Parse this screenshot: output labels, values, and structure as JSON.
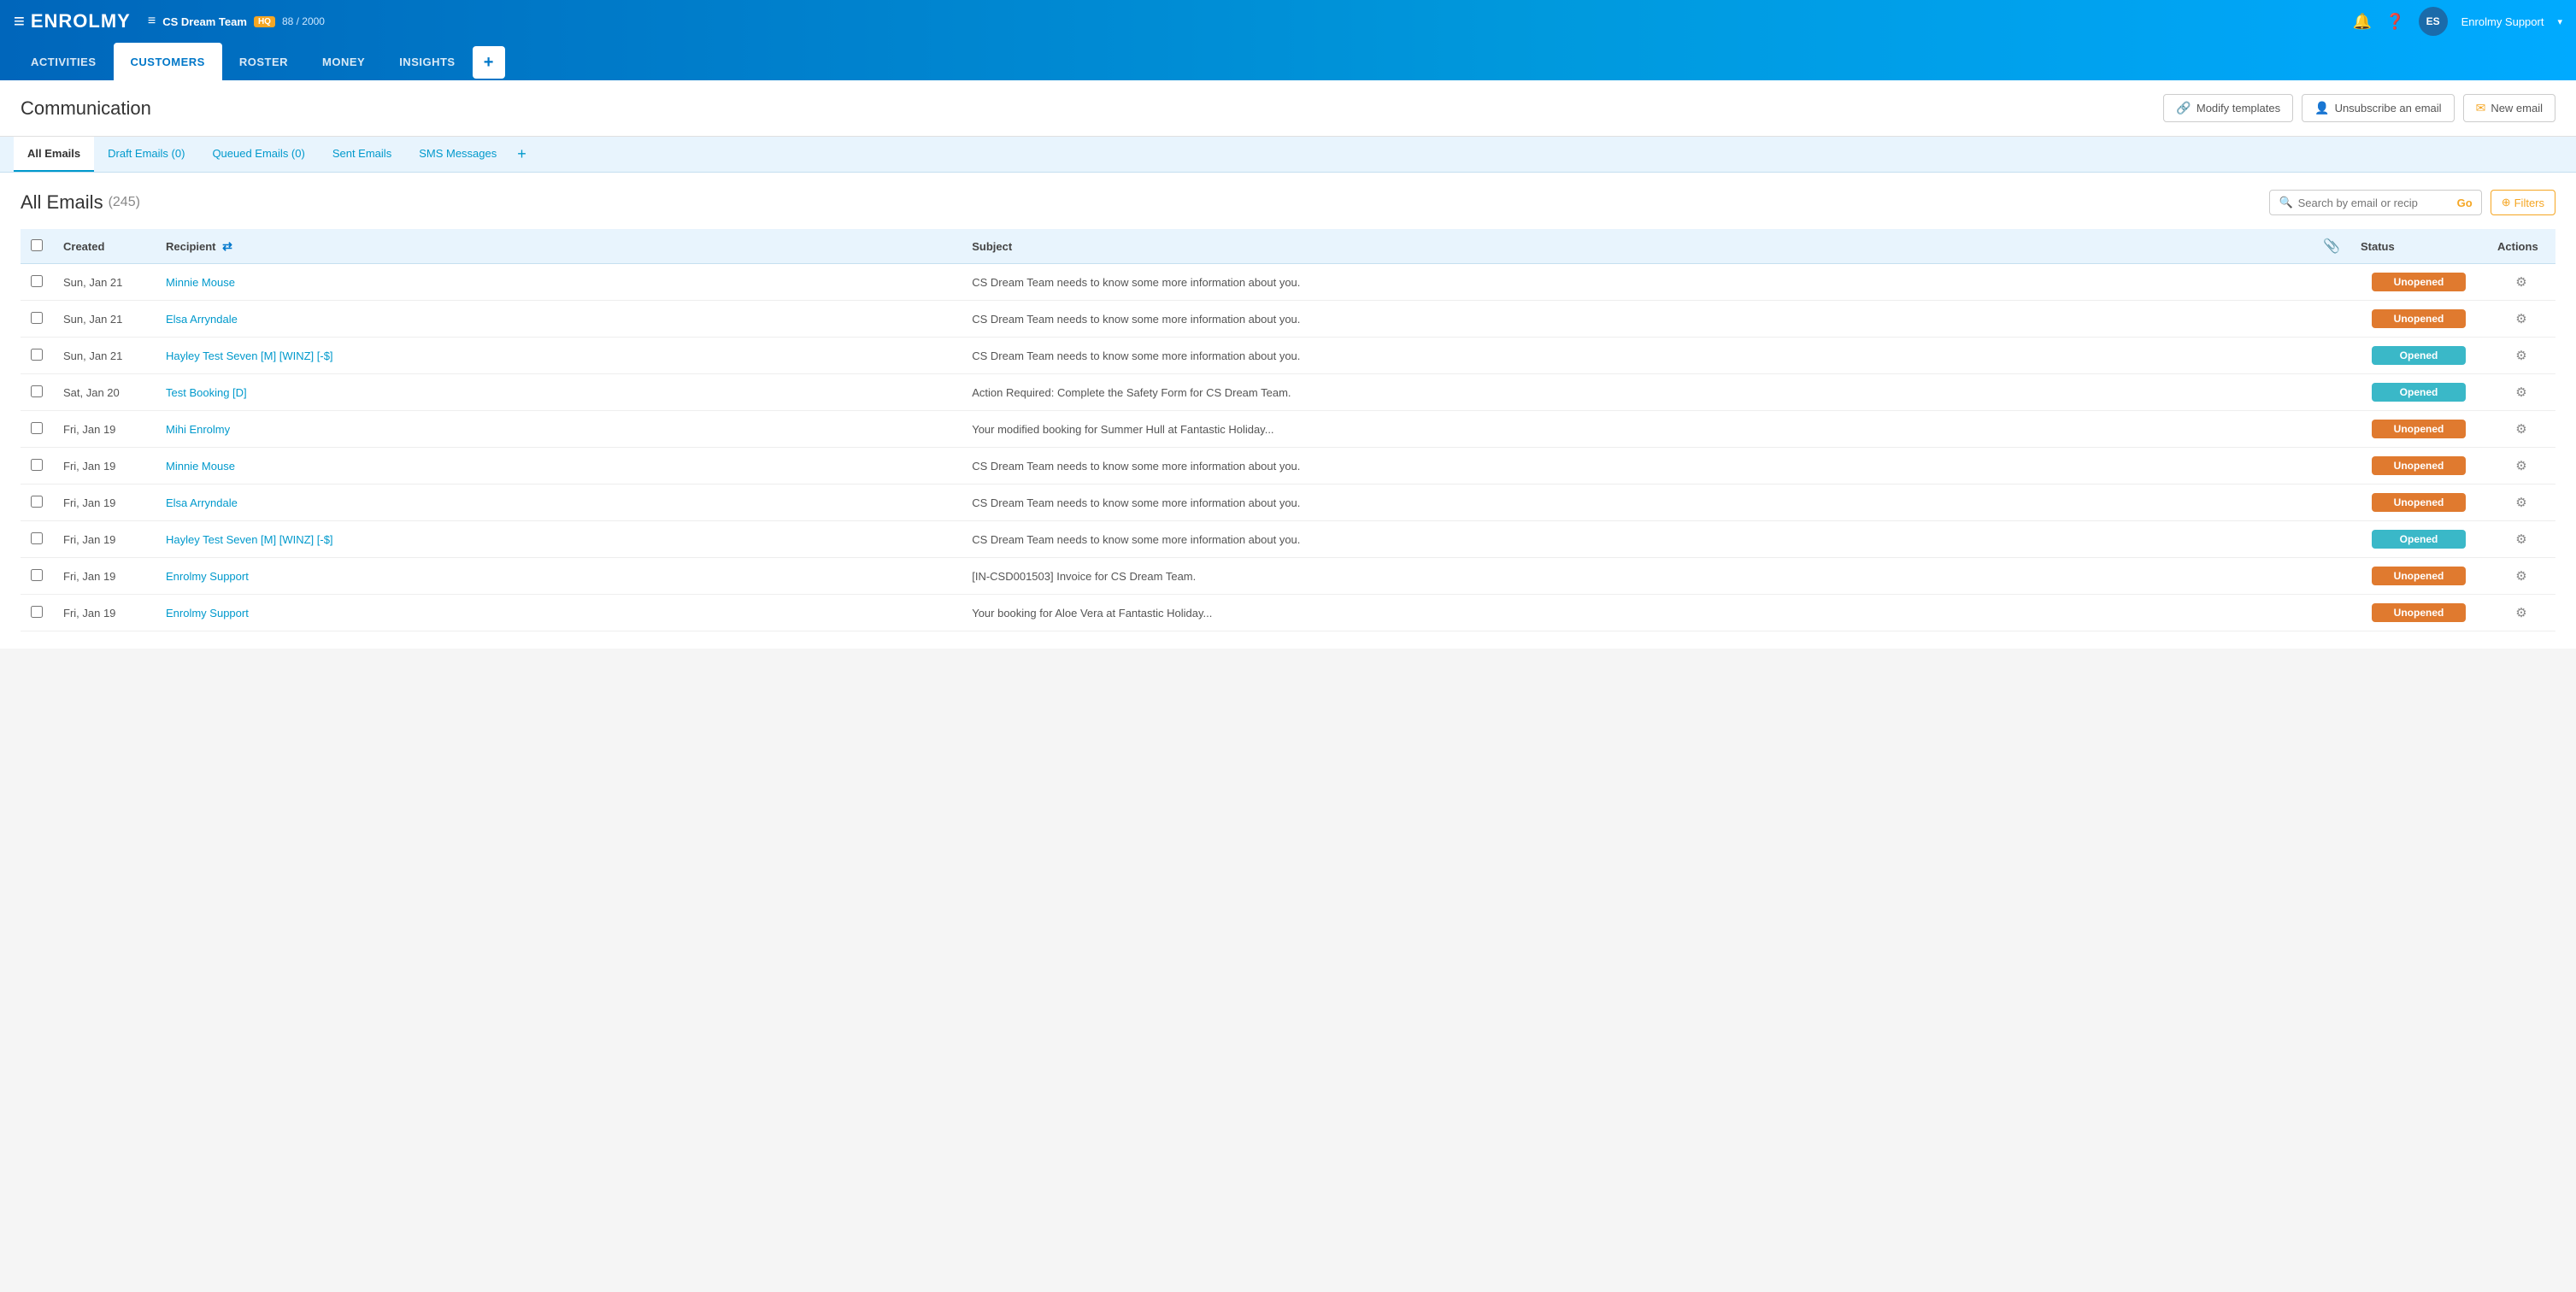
{
  "header": {
    "logo_text": "ENROLMY",
    "hamburger": "≡",
    "org_name": "CS Dream Team",
    "hq_badge": "HQ",
    "org_count": "88 / 2000",
    "avatar_initials": "ES",
    "user_name": "Enrolmy Support",
    "user_caret": "∨"
  },
  "nav": {
    "items": [
      {
        "label": "ACTIVITIES",
        "active": false
      },
      {
        "label": "CUSTOMERS",
        "active": true
      },
      {
        "label": "ROSTER",
        "active": false
      },
      {
        "label": "MONEY",
        "active": false
      },
      {
        "label": "INSIGHTS",
        "active": false
      }
    ],
    "plus": "+"
  },
  "page": {
    "title": "Communication",
    "action_buttons": [
      {
        "icon": "🔗",
        "label": "Modify templates"
      },
      {
        "icon": "👤",
        "label": "Unsubscribe an email"
      },
      {
        "icon": "✉",
        "label": "New email"
      }
    ]
  },
  "tabs": [
    {
      "label": "All Emails",
      "active": true
    },
    {
      "label": "Draft Emails (0)",
      "active": false
    },
    {
      "label": "Queued Emails (0)",
      "active": false
    },
    {
      "label": "Sent Emails",
      "active": false
    },
    {
      "label": "SMS Messages",
      "active": false
    }
  ],
  "emails_section": {
    "title": "All Emails",
    "count": "(245)",
    "search_placeholder": "Search by email or recip",
    "go_label": "Go",
    "filters_label": "Filters"
  },
  "table": {
    "headers": [
      "",
      "Created",
      "Recipient",
      "",
      "Subject",
      "",
      "Status",
      "Actions"
    ],
    "rows": [
      {
        "created": "Sun, Jan 21",
        "recipient": "Minnie Mouse",
        "subject": "CS Dream Team needs to know some more information about you.",
        "has_attachment": false,
        "status": "Unopened",
        "status_type": "unopened"
      },
      {
        "created": "Sun, Jan 21",
        "recipient": "Elsa Arryndale",
        "subject": "CS Dream Team needs to know some more information about you.",
        "has_attachment": false,
        "status": "Unopened",
        "status_type": "unopened"
      },
      {
        "created": "Sun, Jan 21",
        "recipient": "Hayley Test Seven [M] [WINZ] [-$]",
        "subject": "CS Dream Team needs to know some more information about you.",
        "has_attachment": false,
        "status": "Opened",
        "status_type": "opened"
      },
      {
        "created": "Sat, Jan 20",
        "recipient": "Test Booking [D]",
        "subject": "Action Required: Complete the Safety Form for CS Dream Team.",
        "has_attachment": false,
        "status": "Opened",
        "status_type": "opened"
      },
      {
        "created": "Fri, Jan 19",
        "recipient": "Mihi Enrolmy",
        "subject": "Your modified booking for Summer Hull at Fantastic Holiday...",
        "has_attachment": false,
        "status": "Unopened",
        "status_type": "unopened"
      },
      {
        "created": "Fri, Jan 19",
        "recipient": "Minnie Mouse",
        "subject": "CS Dream Team needs to know some more information about you.",
        "has_attachment": false,
        "status": "Unopened",
        "status_type": "unopened"
      },
      {
        "created": "Fri, Jan 19",
        "recipient": "Elsa Arryndale",
        "subject": "CS Dream Team needs to know some more information about you.",
        "has_attachment": false,
        "status": "Unopened",
        "status_type": "unopened"
      },
      {
        "created": "Fri, Jan 19",
        "recipient": "Hayley Test Seven [M] [WINZ] [-$]",
        "subject": "CS Dream Team needs to know some more information about you.",
        "has_attachment": false,
        "status": "Opened",
        "status_type": "opened"
      },
      {
        "created": "Fri, Jan 19",
        "recipient": "Enrolmy Support",
        "subject": "[IN-CSD001503] Invoice for CS Dream Team.",
        "has_attachment": false,
        "status": "Unopened",
        "status_type": "unopened"
      },
      {
        "created": "Fri, Jan 19",
        "recipient": "Enrolmy Support",
        "subject": "Your booking for Aloe Vera at Fantastic Holiday...",
        "has_attachment": false,
        "status": "Unopened",
        "status_type": "unopened"
      }
    ]
  },
  "colors": {
    "nav_bg": "#0077c8",
    "unopened": "#e07a2f",
    "opened": "#3ab8c8",
    "link": "#0099cc"
  }
}
